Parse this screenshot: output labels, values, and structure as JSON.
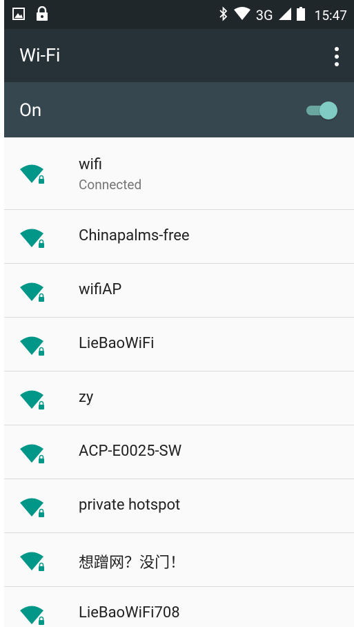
{
  "status_bar": {
    "left_icons": [
      "image-icon",
      "lock-icon"
    ],
    "right_icons": [
      "bluetooth-icon",
      "wifi-signal-icon",
      "cell-signal-icon",
      "battery-icon"
    ],
    "network": "3G",
    "time": "15:47"
  },
  "toolbar": {
    "title": "Wi-Fi",
    "menu_icon": "overflow-menu-icon"
  },
  "wifi_switch": {
    "label": "On",
    "state": "on"
  },
  "networks": [
    {
      "name": "wifi",
      "status": "Connected"
    },
    {
      "name": "Chinapalms-free"
    },
    {
      "name": "wifiAP"
    },
    {
      "name": "LieBaoWiFi"
    },
    {
      "name": "zy"
    },
    {
      "name": "ACP-E0025-SW"
    },
    {
      "name": "private hotspot"
    },
    {
      "name": "想蹭网？没门！"
    },
    {
      "name": "LieBaoWiFi708"
    }
  ],
  "colors": {
    "status_bar": "#1f272b",
    "toolbar": "#263238",
    "switch_bar": "#37474f",
    "accent": "#009688",
    "toggle_thumb": "#80cbc4",
    "list_background": "#fafafa",
    "divider": "#dcdcdc",
    "primary_text": "#212121",
    "secondary_text": "#757575"
  }
}
